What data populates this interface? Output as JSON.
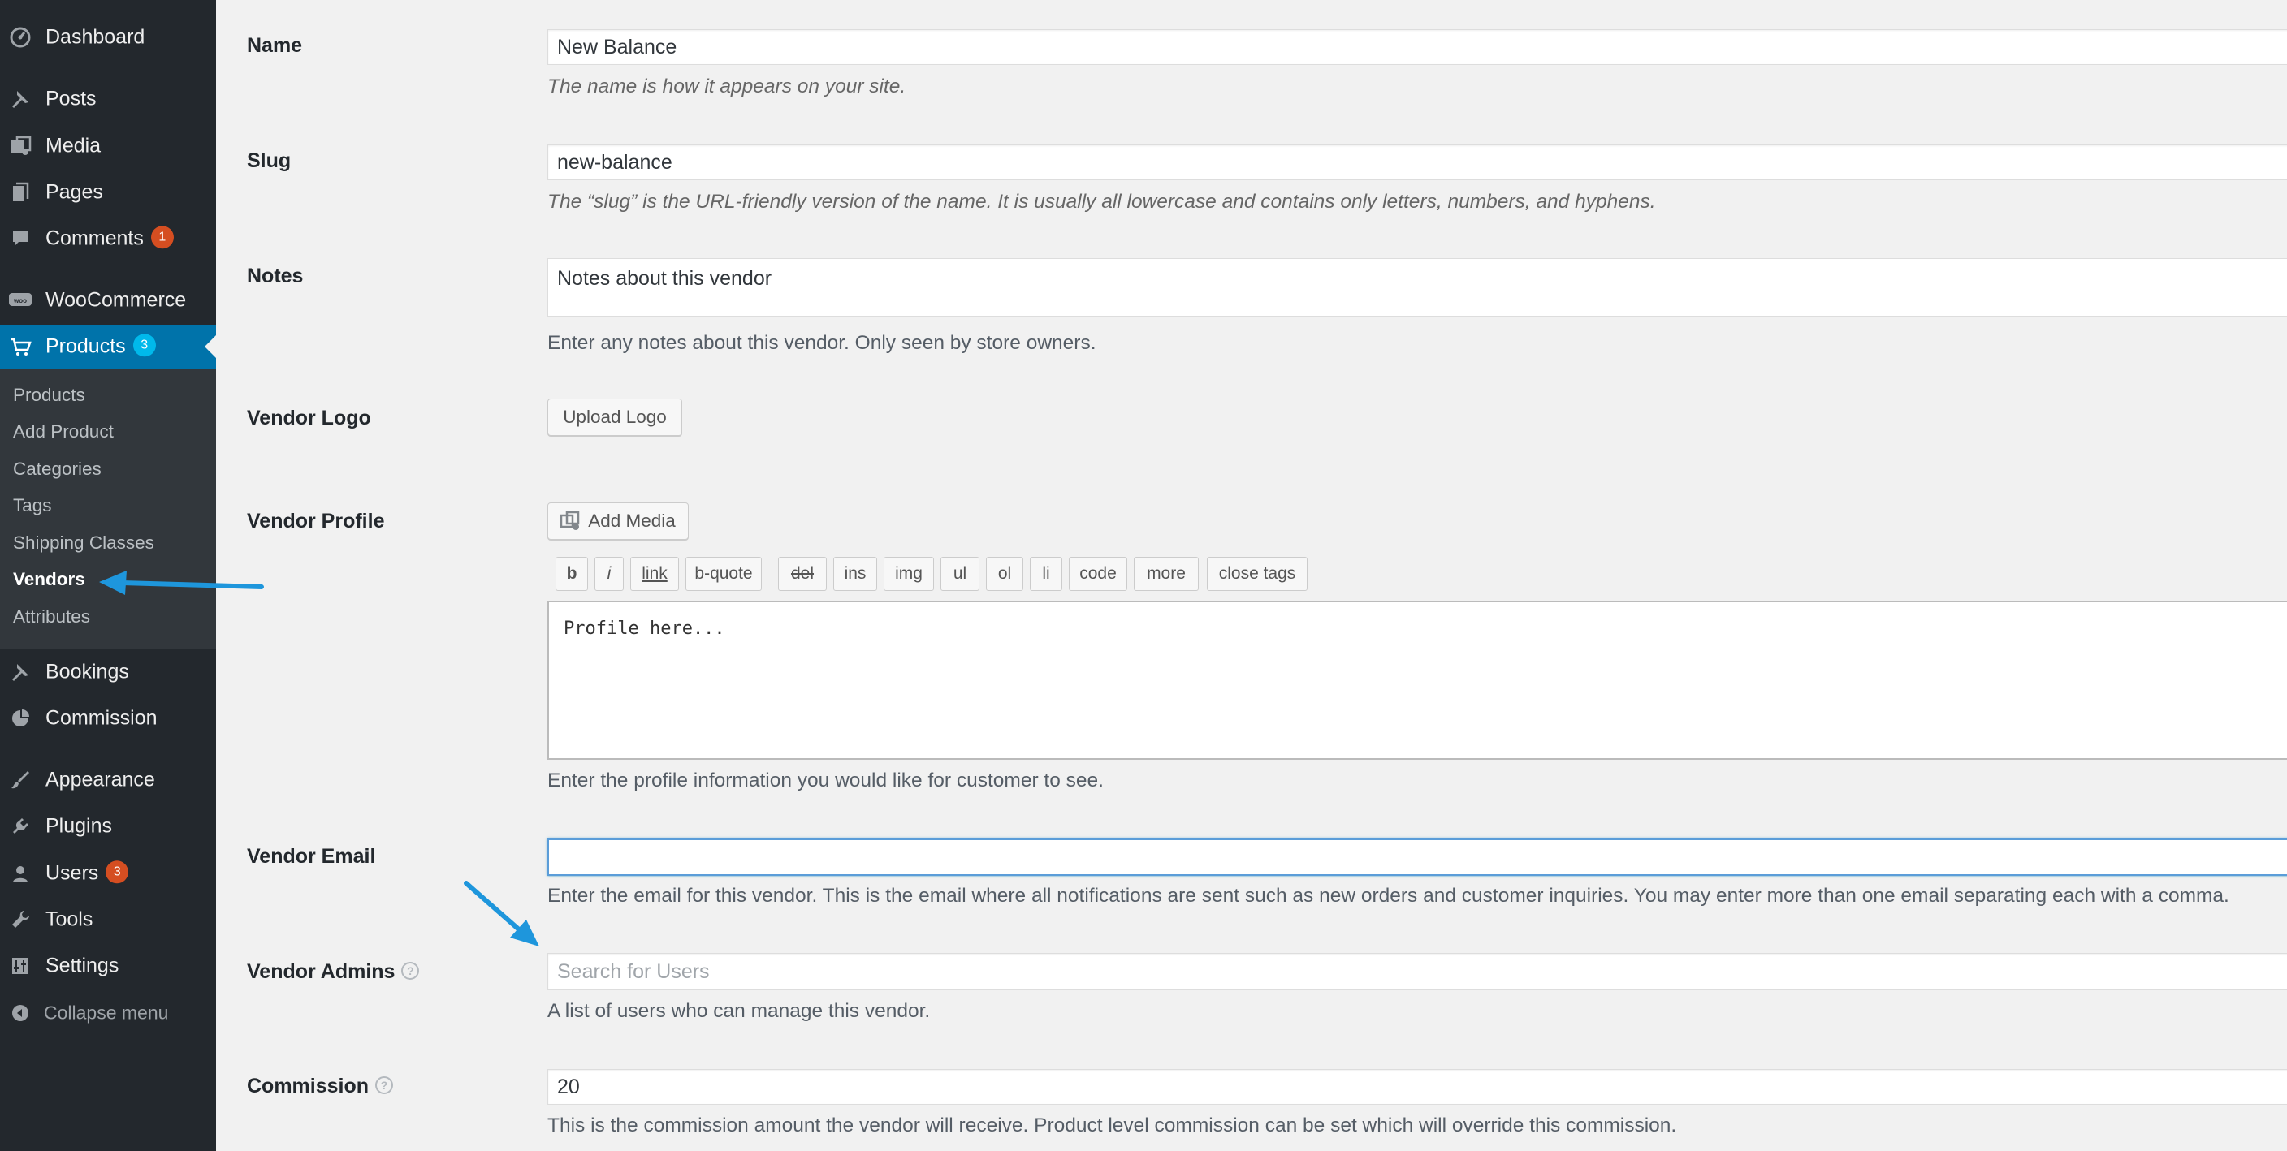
{
  "sidebar": {
    "dashboard": "Dashboard",
    "posts": "Posts",
    "media": "Media",
    "pages": "Pages",
    "comments": "Comments",
    "comments_badge": "1",
    "woocommerce": "WooCommerce",
    "products": "Products",
    "products_badge": "3",
    "submenu": [
      "Products",
      "Add Product",
      "Categories",
      "Tags",
      "Shipping Classes",
      "Vendors",
      "Attributes"
    ],
    "bookings": "Bookings",
    "commission": "Commission",
    "appearance": "Appearance",
    "plugins": "Plugins",
    "users": "Users",
    "users_badge": "3",
    "tools": "Tools",
    "settings": "Settings",
    "collapse": "Collapse menu"
  },
  "form": {
    "name": {
      "label": "Name",
      "value": "New Balance",
      "description": "The name is how it appears on your site."
    },
    "slug": {
      "label": "Slug",
      "value": "new-balance",
      "description": "The “slug” is the URL-friendly version of the name. It is usually all lowercase and contains only letters, numbers, and hyphens."
    },
    "notes": {
      "label": "Notes",
      "value": "Notes about this vendor",
      "description": "Enter any notes about this vendor. Only seen by store owners."
    },
    "logo": {
      "label": "Vendor Logo",
      "button": "Upload Logo"
    },
    "profile": {
      "label": "Vendor Profile",
      "add_media": "Add Media",
      "quicktags": [
        "b",
        "i",
        "link",
        "b-quote",
        "del",
        "ins",
        "img",
        "ul",
        "ol",
        "li",
        "code",
        "more",
        "close tags"
      ],
      "content": "Profile here...",
      "description": "Enter the profile information you would like for customer to see."
    },
    "email": {
      "label": "Vendor Email",
      "value": "",
      "description": "Enter the email for this vendor. This is the email where all notifications are sent such as new orders and customer inquiries. You may enter more than one email separating each with a comma."
    },
    "admins": {
      "label": "Vendor Admins",
      "placeholder": "Search for Users",
      "description": "A list of users who can manage this vendor."
    },
    "commission": {
      "label": "Commission",
      "value": "20",
      "description": "This is the commission amount the vendor will receive. Product level commission can be set which will override this commission."
    }
  },
  "colors": {
    "sidebar_bg": "#23282d",
    "submenu_bg": "#32373c",
    "accent": "#0073aa",
    "badge": "#d54e21",
    "annotation_arrow": "#1e96dc"
  },
  "icons": {
    "dashboard": "dashboard-icon",
    "posts": "pin-icon",
    "media": "media-icon",
    "pages": "pages-icon",
    "comments": "comment-icon",
    "woocommerce": "woo-icon",
    "products": "cart-icon",
    "bookings": "pin-icon",
    "commission": "pie-chart-icon",
    "appearance": "brush-icon",
    "plugins": "plug-icon",
    "users": "user-icon",
    "tools": "wrench-icon",
    "settings": "sliders-icon",
    "collapse": "collapse-icon"
  }
}
